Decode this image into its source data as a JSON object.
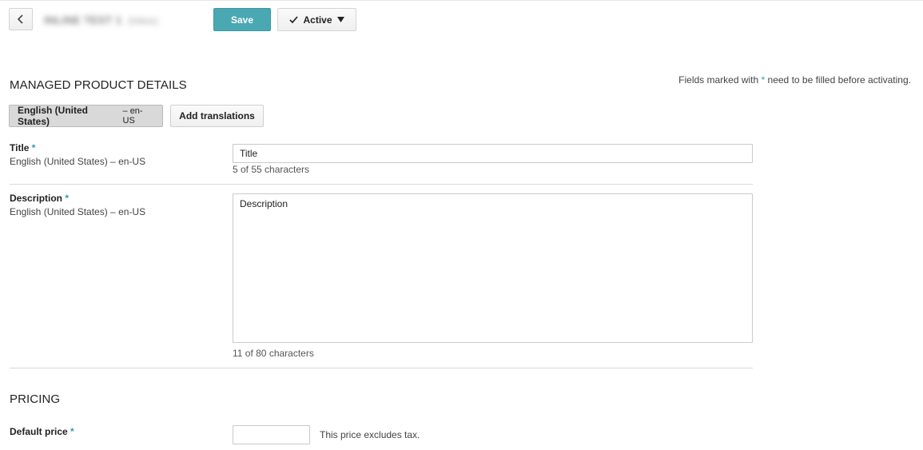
{
  "header": {
    "back_icon": "chevron-left-icon",
    "app_name": "INLINE TEST 1",
    "app_name_sub": "(Inbox)",
    "save_label": "Save",
    "status_icon": "check-icon",
    "status_label": "Active",
    "status_dropdown_icon": "caret-down-icon"
  },
  "product_details": {
    "section_title": "MANAGED PRODUCT DETAILS",
    "required_note_before": "Fields marked with ",
    "required_note_asterisk": "*",
    "required_note_after": " need to be filled before activating.",
    "language_tab": {
      "label": "English (United States)",
      "code": "– en-US"
    },
    "add_translations_label": "Add translations",
    "title_field": {
      "label": "Title",
      "asterisk": "*",
      "language": "English (United States) – en-US",
      "value": "Title",
      "counter": "5 of 55 characters"
    },
    "description_field": {
      "label": "Description",
      "asterisk": "*",
      "language": "English (United States) – en-US",
      "value": "Description",
      "counter": "11 of 80 characters"
    }
  },
  "pricing": {
    "section_title": "PRICING",
    "default_price_label": "Default price",
    "asterisk": "*",
    "price_value": "",
    "price_note": "This price excludes tax."
  },
  "colors": {
    "accent": "#4aa8b3",
    "asterisk": "#3a9aa5"
  }
}
